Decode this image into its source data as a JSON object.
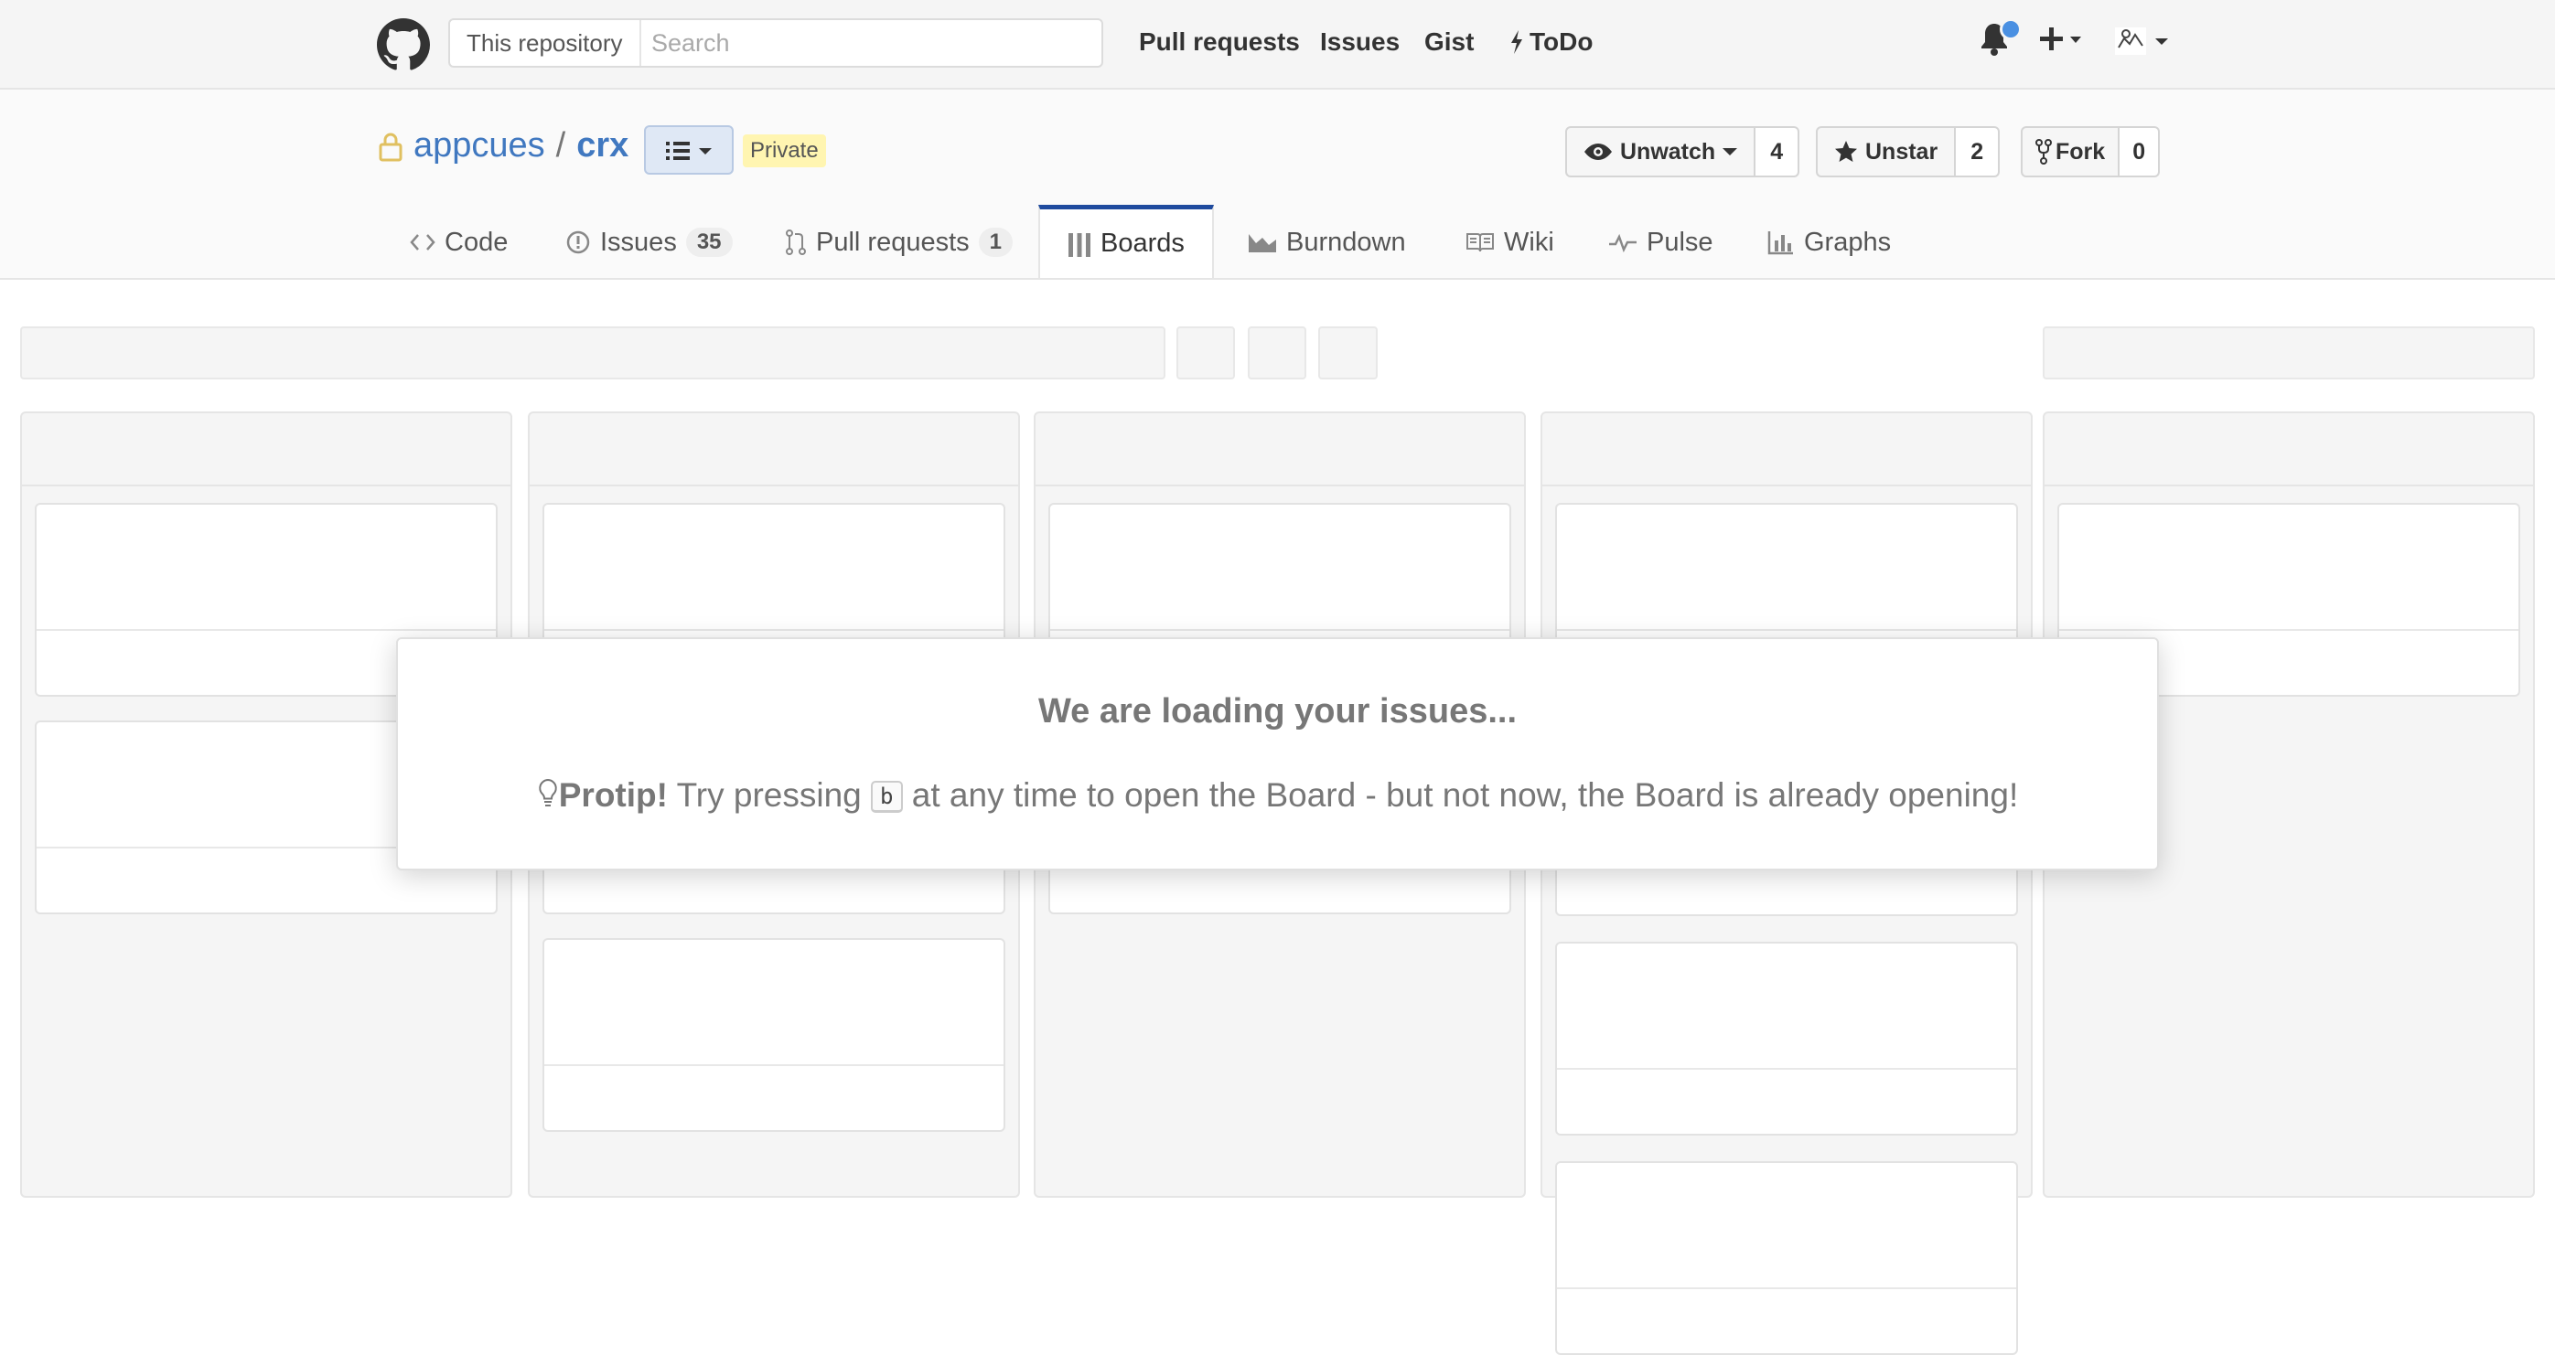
{
  "header": {
    "search_scope": "This repository",
    "search_placeholder": "Search",
    "nav": [
      "Pull requests",
      "Issues",
      "Gist",
      "ToDo"
    ],
    "icons": [
      "github-logo-icon",
      "bell-icon",
      "plus-icon",
      "avatar"
    ],
    "notification_color": "#4a90e2"
  },
  "repo": {
    "owner": "appcues",
    "separator": "/",
    "name": "crx",
    "visibility": "Private",
    "watch_label": "Unwatch",
    "watch_count": "4",
    "star_label": "Unstar",
    "star_count": "2",
    "fork_label": "Fork",
    "fork_count": "0"
  },
  "tabs": {
    "code": "Code",
    "issues": "Issues",
    "issues_count": "35",
    "pulls": "Pull requests",
    "pulls_count": "1",
    "boards": "Boards",
    "burndown": "Burndown",
    "wiki": "Wiki",
    "pulse": "Pulse",
    "graphs": "Graphs",
    "active_color": "#1f4b9e"
  },
  "modal": {
    "title": "We are loading your issues...",
    "protip_label": "Protip!",
    "tip_before": "Try pressing",
    "key": "b",
    "tip_after": "at any time to open the Board - but not now, the Board is already opening!"
  }
}
